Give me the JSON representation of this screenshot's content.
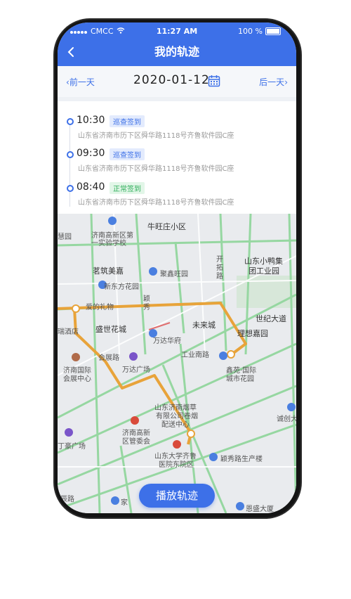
{
  "status_bar": {
    "carrier": "CMCC",
    "time": "11:27 AM",
    "battery": "100 %"
  },
  "header": {
    "title": "我的轨迹",
    "back_icon": "chevron-left-icon"
  },
  "date_nav": {
    "prev_label": "前一天",
    "date": "2020-01-12",
    "next_label": "后一天",
    "calendar_icon": "calendar-icon"
  },
  "records": [
    {
      "time": "10:30",
      "tag": "巡查签到",
      "address": "山东省济南市历下区舜华路1118号齐鲁软件园C座"
    },
    {
      "time": "09:30",
      "tag": "巡查签到",
      "address": "山东省济南市历下区舜华路1118号齐鲁软件园C座"
    },
    {
      "time": "08:40",
      "tag": "正常签到",
      "address": "山东省济南市历下区舜华路1118号齐鲁软件园C座"
    }
  ],
  "map": {
    "labels": {
      "l1": "牛旺庄小区",
      "l2": "济南高新区第",
      "l3": "一实验学校",
      "l4": "慧园",
      "l5": "开",
      "l6": "拓",
      "l7": "路",
      "l8": "山东小鸭集",
      "l9": "团工业园",
      "l10": "茗筑美嘉",
      "l11": "聚鑫旺园",
      "l12": "新东方花园",
      "l13": "颖",
      "l14": "秀",
      "l15": "爱的礼物",
      "l16": "世纪大道",
      "l17": "瑞酒店",
      "l18": "盛世花城",
      "l19": "未来城",
      "l20": "理想嘉园",
      "l21": "万达华府",
      "l22": "会展路",
      "l23": "工业南路",
      "l24": "万达广场",
      "l25": "鑫苑·国际",
      "l26": "城市花园",
      "l27": "济南国际",
      "l28": "会展中心",
      "l29": "山东济南烟草",
      "l30": "有限公司卷烟",
      "l31": "配送中心",
      "l32": "诚创大",
      "l33": "济南高新",
      "l34": "区管委会",
      "l35": "丁豪广场",
      "l36": "山东大学齐鲁",
      "l37": "医院东院区",
      "l38": "颖秀路生产楼",
      "l39": "辰路",
      "l40": "家",
      "l41": "恩盛大厦"
    },
    "play_button": "播放轨迹"
  },
  "colors": {
    "primary": "#3d70e8",
    "route": "#e8a33a",
    "road": "#8fd59a"
  }
}
